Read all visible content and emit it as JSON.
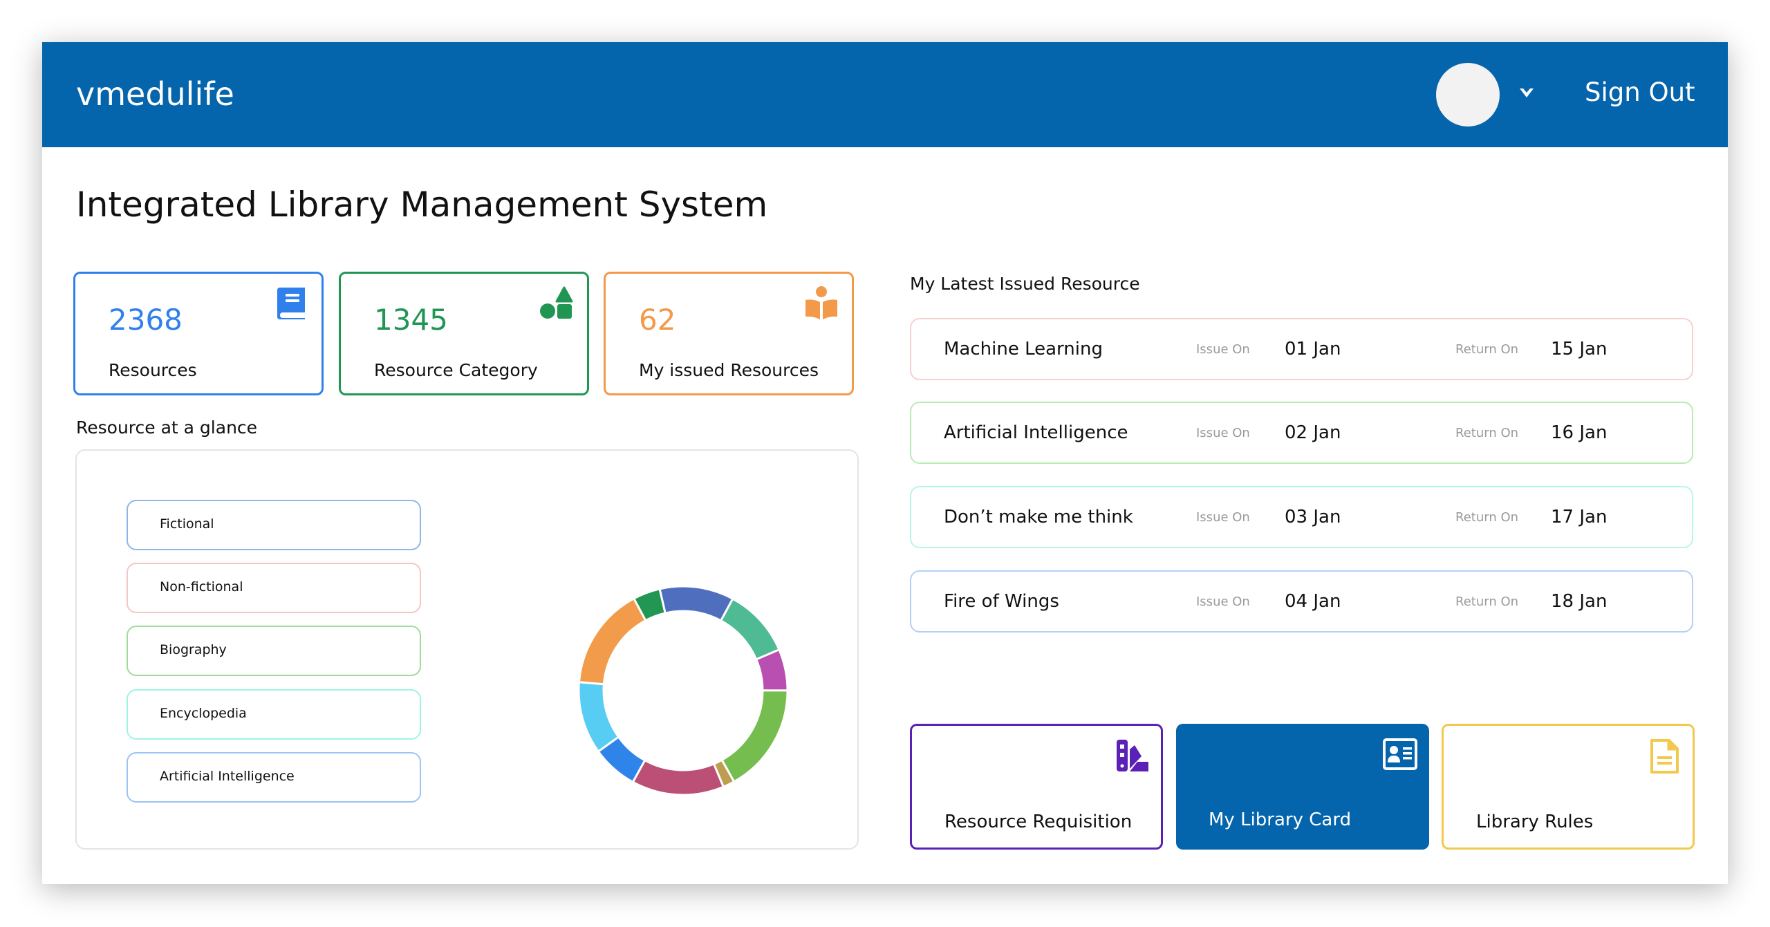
{
  "header": {
    "brand": "vmedulife",
    "sign_out_label": "Sign Out",
    "brand_color": "#0565ac"
  },
  "page_title": "Integrated Library Management System",
  "stats": [
    {
      "value": "2368",
      "label": "Resources",
      "icon": "book-icon",
      "color": "#2f80ed"
    },
    {
      "value": "1345",
      "label": "Resource Category",
      "icon": "shapes-icon",
      "color": "#219653"
    },
    {
      "value": "62",
      "label": "My issued Resources",
      "icon": "reader-icon",
      "color": "#f2994a"
    }
  ],
  "glance": {
    "title": "Resource at a glance",
    "legend": [
      {
        "label": "Fictional",
        "border": "#8fb6e6"
      },
      {
        "label": "Non-fictional",
        "border": "#f5c6c6"
      },
      {
        "label": "Biography",
        "border": "#9fdc9a"
      },
      {
        "label": "Encyclopedia",
        "border": "#9ff3e3"
      },
      {
        "label": "Artificial Intelligence",
        "border": "#9cc3f3"
      }
    ]
  },
  "chart_data": {
    "type": "pie",
    "title": "",
    "donut": true,
    "slice_labels": [],
    "values": [
      11.5,
      10.7,
      6.4,
      16.9,
      1.8,
      14.3,
      7.1,
      11.2,
      15.9,
      4.2
    ],
    "colors": [
      "#4f6fbe",
      "#4fbb94",
      "#b94fb1",
      "#75bd4f",
      "#bd9d4f",
      "#bc4f75",
      "#2f84ea",
      "#58cdf3",
      "#f29b4b",
      "#229653"
    ],
    "legend": [
      "Fictional",
      "Non-fictional",
      "Biography",
      "Encyclopedia",
      "Artificial Intelligence"
    ]
  },
  "issued": {
    "title": "My Latest Issued Resource",
    "issue_label": "Issue On",
    "return_label": "Return On",
    "rows": [
      {
        "title": "Machine Learning",
        "issue_on": "01 Jan",
        "return_on": "15 Jan",
        "border": "#f7d0d0"
      },
      {
        "title": "Artificial Intelligence",
        "issue_on": "02 Jan",
        "return_on": "16 Jan",
        "border": "#b9ecb4"
      },
      {
        "title": "Don’t make me think",
        "issue_on": "03 Jan",
        "return_on": "17 Jan",
        "border": "#b6f6ea"
      },
      {
        "title": "Fire of Wings",
        "issue_on": "04 Jan",
        "return_on": "18 Jan",
        "border": "#b3cff5"
      }
    ]
  },
  "actions": [
    {
      "label": "Resource Requisition",
      "icon": "swatch-book-icon",
      "color": "#5b21b6"
    },
    {
      "label": "My Library Card",
      "icon": "id-card-icon",
      "color": "#0565ac"
    },
    {
      "label": "Library Rules",
      "icon": "document-icon",
      "color": "#f2c94c"
    }
  ]
}
